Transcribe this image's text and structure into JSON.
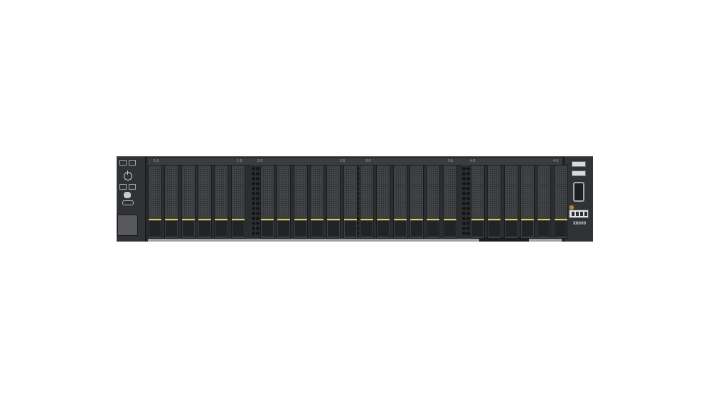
{
  "slot_labels": [
    "1-0",
    "1-5",
    "2-0",
    "2-5",
    "3-0",
    "3-5",
    "4-0",
    "4-5"
  ],
  "model_label": "X6000",
  "drive_count": 24,
  "colors": {
    "chassis": "#2b2d2f",
    "drive_stripe": "#d9d24a",
    "background": "#ffffff"
  },
  "icons": [
    "power-icon",
    "uid-icon",
    "usb-port",
    "vga-port",
    "dip-switch",
    "ground-screw"
  ]
}
